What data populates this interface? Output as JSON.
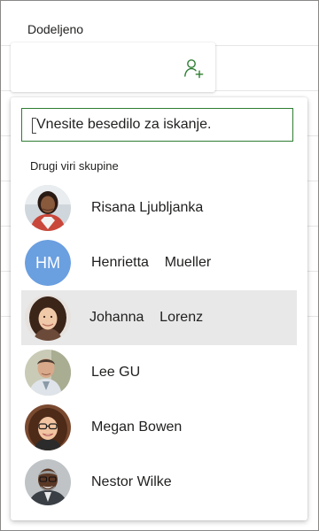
{
  "assigned": {
    "label": "Dodeljeno"
  },
  "icons": {
    "add_person": "add-person-icon"
  },
  "search": {
    "placeholder": "Vnesite besedilo za iskanje."
  },
  "section": {
    "header": "Drugi viri skupine"
  },
  "colors": {
    "accent": "#2e7d32",
    "hm_avatar": "#6a9fe0",
    "selected_row": "#e8e8e8"
  },
  "people": [
    {
      "name": "Risana Ljubljanka",
      "avatar": "photo",
      "selected": false
    },
    {
      "name": "Henrietta    Mueller",
      "avatar": "initials",
      "initials": "HM",
      "selected": false
    },
    {
      "name": "Johanna    Lorenz",
      "avatar": "photo",
      "selected": true
    },
    {
      "name": "Lee GU",
      "avatar": "photo",
      "selected": false
    },
    {
      "name": "Megan Bowen",
      "avatar": "photo",
      "selected": false
    },
    {
      "name": "Nestor Wilke",
      "avatar": "photo",
      "selected": false
    }
  ]
}
